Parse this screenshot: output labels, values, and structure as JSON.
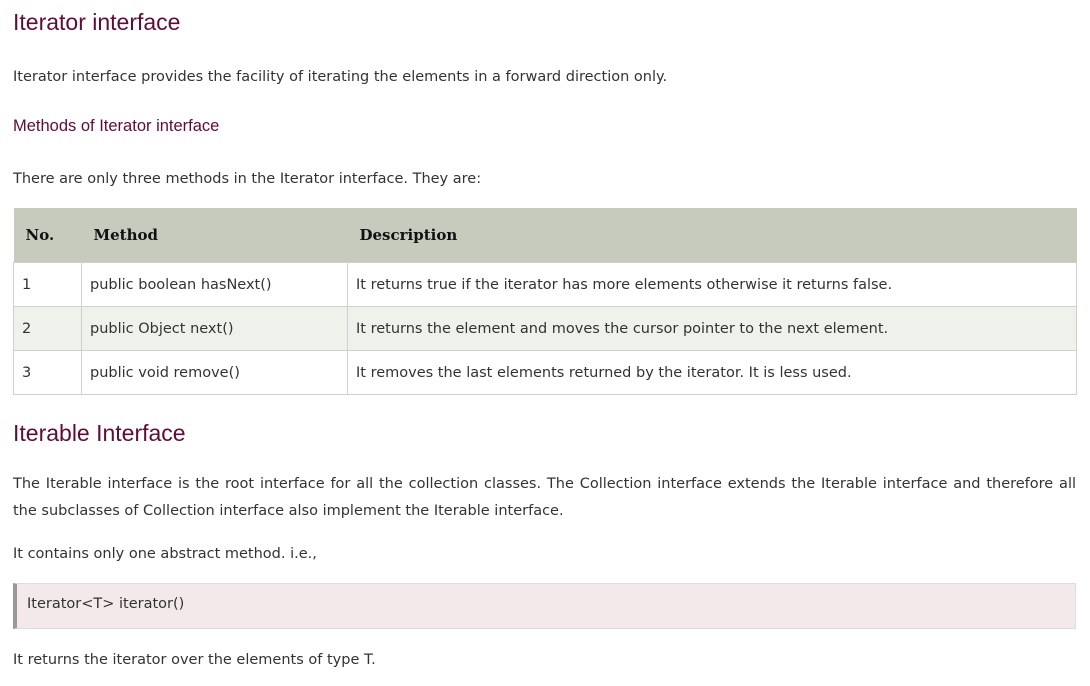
{
  "iterator_section": {
    "heading": "Iterator interface",
    "intro": "Iterator interface provides the facility of iterating the elements in a forward direction only.",
    "methods_heading": "Methods of Iterator interface",
    "methods_intro": "There are only three methods in the Iterator interface. They are:",
    "table": {
      "headers": [
        "No.",
        "Method",
        "Description"
      ],
      "rows": [
        {
          "no": "1",
          "method": "public boolean hasNext()",
          "description": "It returns true if the iterator has more elements otherwise it returns false."
        },
        {
          "no": "2",
          "method": "public Object next()",
          "description": "It returns the element and moves the cursor pointer to the next element."
        },
        {
          "no": "3",
          "method": "public void remove()",
          "description": "It removes the last elements returned by the iterator. It is less used."
        }
      ]
    }
  },
  "iterable_section": {
    "heading": "Iterable Interface",
    "paragraph": "The Iterable interface is the root interface for all the collection classes. The Collection interface extends the Iterable interface and therefore all the subclasses of Collection interface also implement the Iterable interface.",
    "abstract_note": "It contains only one abstract method. i.e.,",
    "code": "Iterator<T> iterator()",
    "returns_note": "It returns the iterator over the elements of type T."
  }
}
